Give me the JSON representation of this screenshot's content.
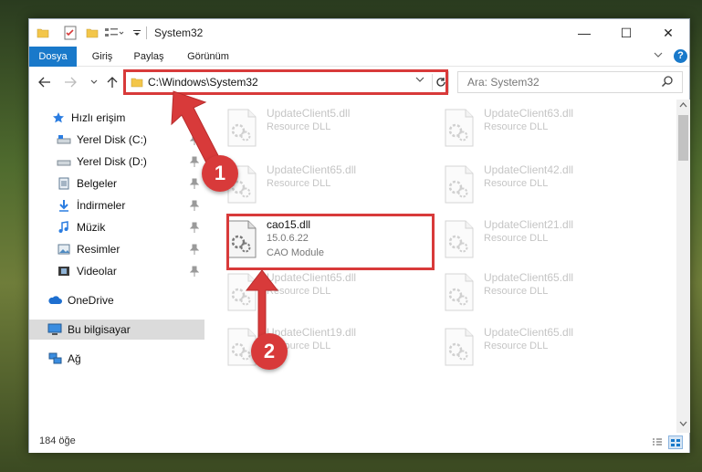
{
  "titlebar": {
    "title": "System32",
    "controls": {
      "minimize": "—",
      "maximize": "☐",
      "close": "✕"
    }
  },
  "ribbon": {
    "tabs": [
      "Dosya",
      "Giriş",
      "Paylaş",
      "Görünüm"
    ],
    "help": "?"
  },
  "address": {
    "path": "C:\\Windows\\System32",
    "search_placeholder": "Ara: System32"
  },
  "sidebar": {
    "quick_access": "Hızlı erişim",
    "items": [
      {
        "label": "Yerel Disk (C:)",
        "icon": "drive-icon",
        "pinned": true
      },
      {
        "label": "Yerel Disk (D:)",
        "icon": "drive-icon",
        "pinned": true
      },
      {
        "label": "Belgeler",
        "icon": "documents-icon",
        "pinned": true
      },
      {
        "label": "İndirmeler",
        "icon": "download-icon",
        "pinned": true
      },
      {
        "label": "Müzik",
        "icon": "music-icon",
        "pinned": true
      },
      {
        "label": "Resimler",
        "icon": "pictures-icon",
        "pinned": true
      },
      {
        "label": "Videolar",
        "icon": "videos-icon",
        "pinned": true
      }
    ],
    "onedrive": "OneDrive",
    "this_pc": "Bu bilgisayar",
    "network": "Ağ"
  },
  "files": {
    "col1": [
      {
        "name": "UpdateClient5.dll",
        "desc": "Resource DLL"
      },
      {
        "name": "UpdateClient65.dll",
        "desc": "Resource DLL"
      },
      {
        "name": "cao15.dll",
        "desc": "15.0.6.22",
        "meta": "CAO Module",
        "highlight": true
      },
      {
        "name": "UpdateClient65.dll",
        "desc": "Resource DLL"
      },
      {
        "name": "UpdateClient19.dll",
        "desc": "Resource DLL"
      }
    ],
    "col2": [
      {
        "name": "UpdateClient63.dll",
        "desc": "Resource DLL"
      },
      {
        "name": "UpdateClient42.dll",
        "desc": "Resource DLL"
      },
      {
        "name": "UpdateClient21.dll",
        "desc": "Resource DLL"
      },
      {
        "name": "UpdateClient65.dll",
        "desc": "Resource DLL"
      },
      {
        "name": "UpdateClient65.dll",
        "desc": "Resource DLL"
      }
    ]
  },
  "status": {
    "count": "184 öğe"
  },
  "annotations": {
    "marker1": "1",
    "marker2": "2",
    "color": "#d83a3a"
  }
}
